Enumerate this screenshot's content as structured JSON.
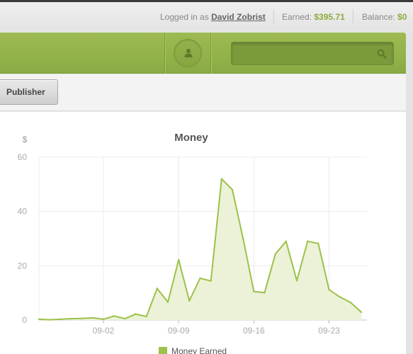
{
  "userbar": {
    "logged_in_prefix": "Logged in as",
    "username": "David Zobrist",
    "earned_label": "Earned:",
    "earned_value": "$395.71",
    "balance_label": "Balance:",
    "balance_value": "$0"
  },
  "navbar": {
    "profile_icon": "user-icon",
    "search_icon": "search-icon",
    "search_value": ""
  },
  "subbar": {
    "publisher_label": "Publisher"
  },
  "colors": {
    "accent": "#8aac3c",
    "series_line": "#9cc24a",
    "series_fill": "#ebf2d7"
  },
  "chart_data": {
    "type": "area",
    "title": "Money",
    "ylabel": "$",
    "ylim": [
      0,
      60
    ],
    "yticks": [
      0,
      20,
      40,
      60
    ],
    "xticks": [
      "09-02",
      "09-09",
      "09-16",
      "09-23"
    ],
    "xtick_positions": [
      6,
      13,
      20,
      27
    ],
    "grid": true,
    "legend_position": "bottom",
    "series": [
      {
        "name": "Money Earned",
        "x": [
          0,
          1,
          2,
          3,
          4,
          5,
          6,
          7,
          8,
          9,
          10,
          11,
          12,
          13,
          14,
          15,
          16,
          17,
          18,
          19,
          20,
          21,
          22,
          23,
          24,
          25,
          26,
          27,
          28,
          29,
          30
        ],
        "values": [
          0.3,
          0.1,
          0.3,
          0.5,
          0.6,
          0.8,
          0.3,
          1.5,
          0.5,
          2.2,
          1.3,
          11.6,
          6.6,
          22.2,
          7.1,
          15.4,
          14.4,
          52.0,
          48.0,
          30.0,
          10.5,
          10.1,
          24.3,
          29.0,
          14.5,
          29.0,
          28.2,
          11.2,
          8.5,
          6.5,
          2.9
        ]
      }
    ]
  }
}
